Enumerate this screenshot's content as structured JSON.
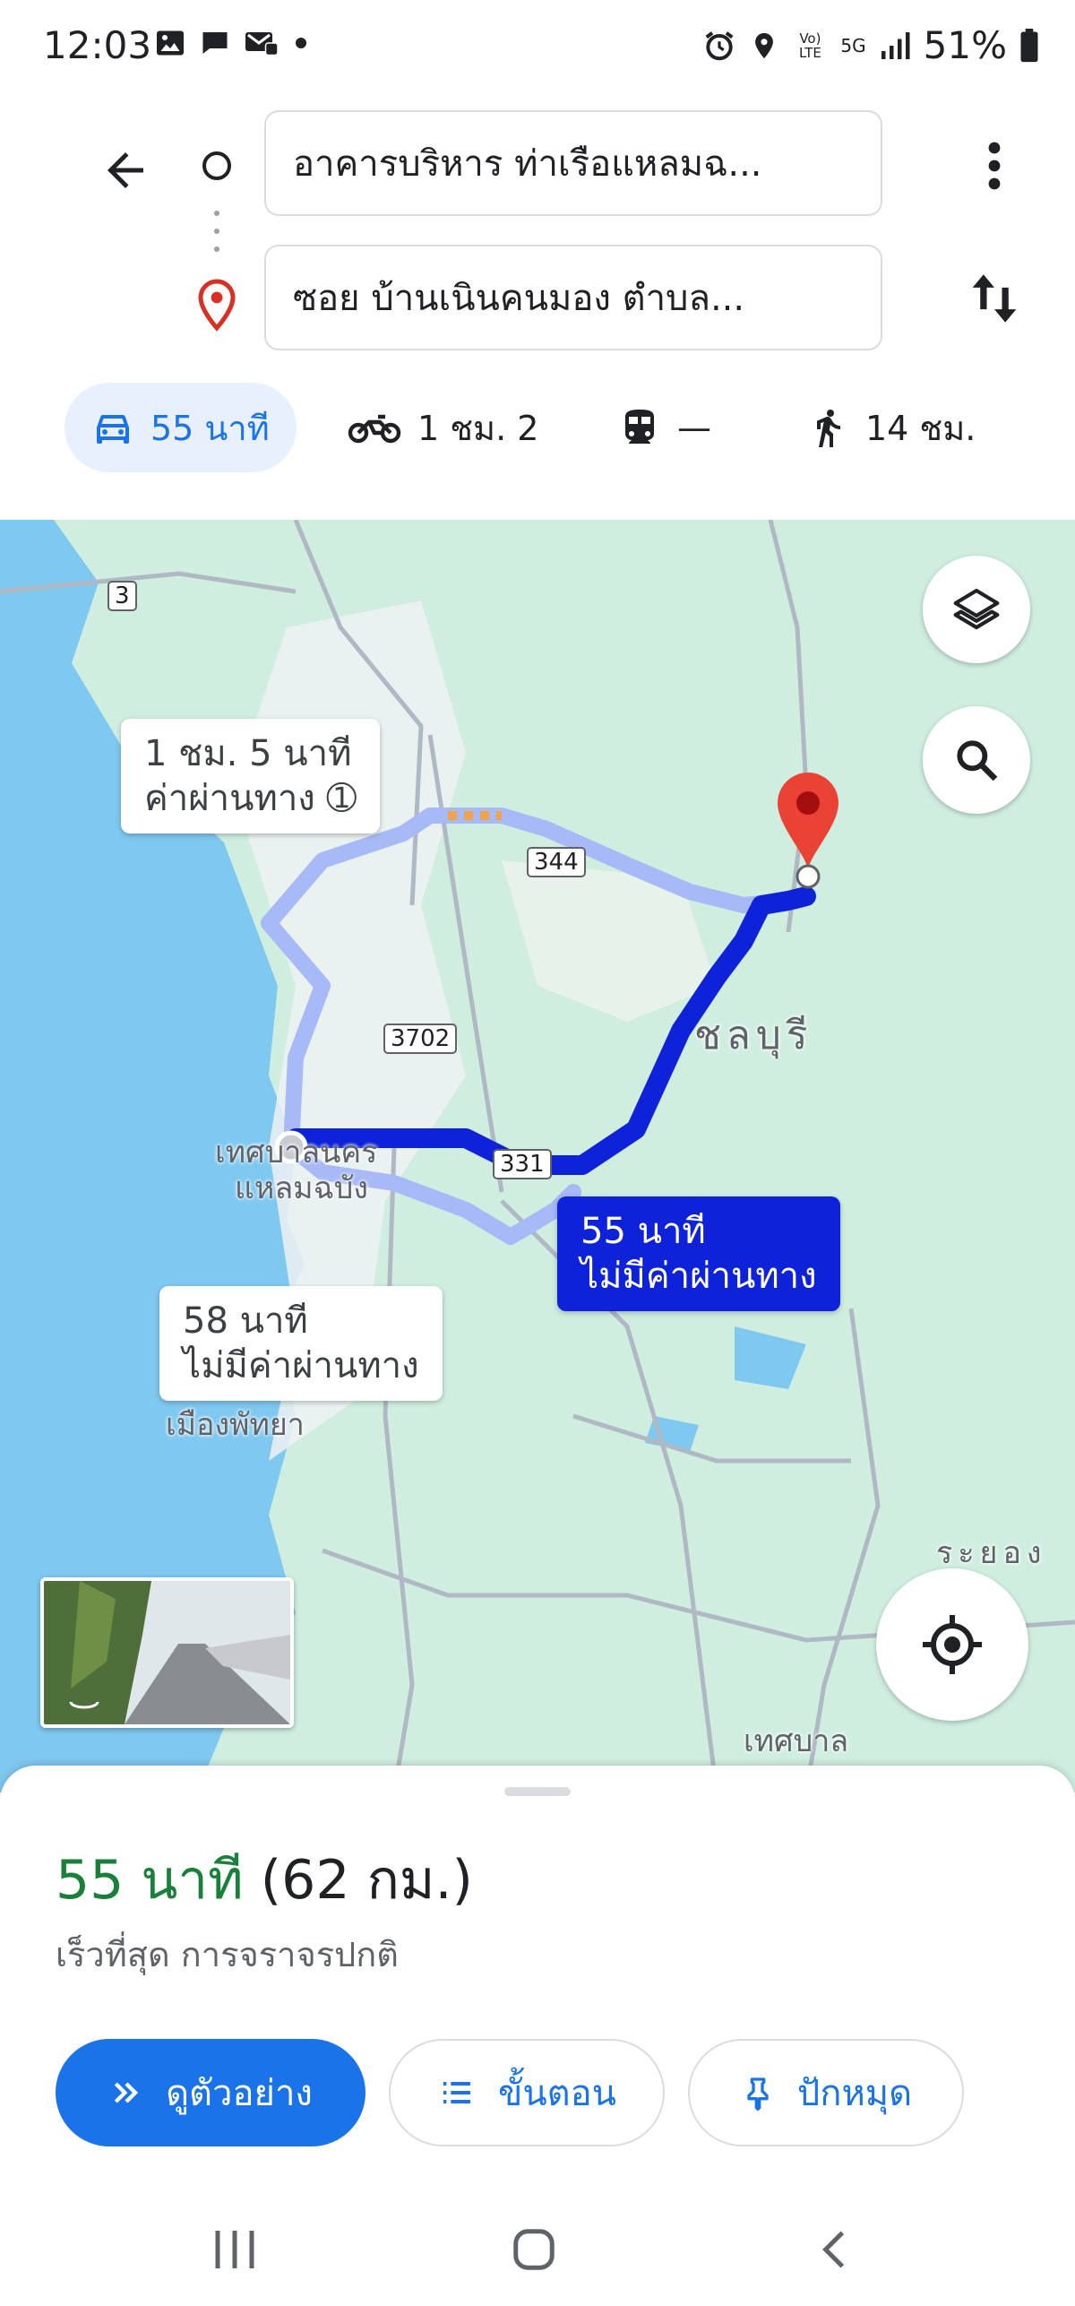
{
  "status_bar": {
    "time": "12:03",
    "battery": "51%",
    "left_icons": [
      "gallery-icon",
      "chat-icon",
      "message-icon",
      "notification-dot-icon"
    ],
    "right_icons": [
      "alarm-icon",
      "location-icon",
      "volte-icon",
      "5g-icon",
      "signal-icon",
      "battery-icon"
    ],
    "volte_text": "Vo) LTE",
    "fiveg_text": "5G"
  },
  "directions": {
    "origin": "อาคารบริหาร ท่าเรือแหลมฉ...",
    "destination": "ซอย บ้านเนินคนมอง ตำบล...",
    "modes": [
      {
        "icon": "car-icon",
        "label": "55 นาที",
        "active": true
      },
      {
        "icon": "motorcycle-icon",
        "label": "1 ชม. 2",
        "active": false
      },
      {
        "icon": "transit-icon",
        "label": "—",
        "active": false
      },
      {
        "icon": "walk-icon",
        "label": "14 ชม.",
        "active": false
      }
    ]
  },
  "map": {
    "route_labels": {
      "alt1_line1": "1 ชม. 5 นาที",
      "alt1_line2": "ค่าผ่านทาง",
      "alt2_line1": "58 นาที",
      "alt2_line2": "ไม่มีค่าผ่านทาง",
      "main_line1": "55 นาที",
      "main_line2": "ไม่มีค่าผ่านทาง"
    },
    "places": {
      "chonburi": "ชลบุรี",
      "laem_chabang_1": "เทศบาลนคร",
      "laem_chabang_2": "แหลมฉบัง",
      "pattaya": "เมืองพัทยา",
      "rayong": "ระยอง",
      "municipality": "เทศบาล"
    },
    "roads": {
      "r3": "3",
      "r344": "344",
      "r3702": "3702",
      "r331": "331"
    },
    "colors": {
      "water": "#7fc8f0",
      "land": "#cfeee0",
      "urban": "#f1f3f4",
      "route_main": "#0d22d9",
      "route_alt": "#a7b9f7",
      "pin": "#ea4335"
    }
  },
  "sheet": {
    "time": "55 นาที",
    "distance": "(62 กม.)",
    "subtitle": "เร็วที่สุด การจราจรปกติ",
    "buttons": {
      "preview": "ดูตัวอย่าง",
      "steps": "ขั้นตอน",
      "pin": "ปักหมุด"
    }
  }
}
